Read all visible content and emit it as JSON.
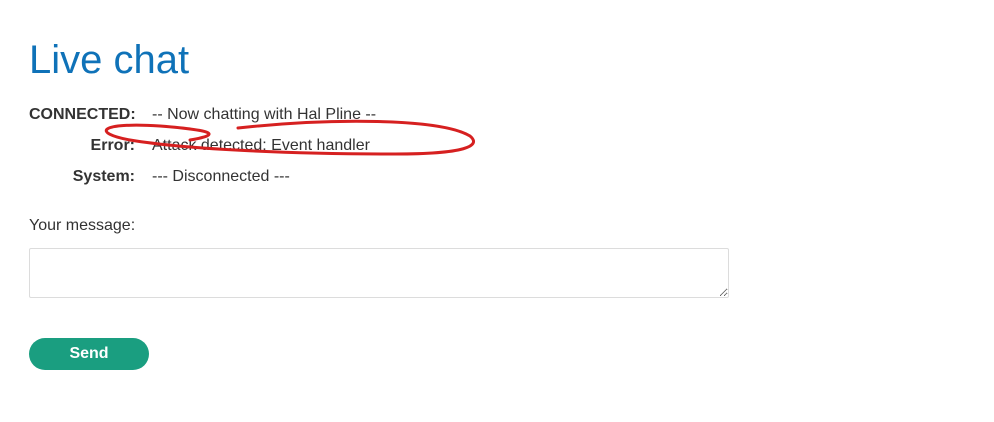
{
  "page": {
    "title": "Live chat"
  },
  "chat": {
    "messages": [
      {
        "label": "CONNECTED:",
        "text": "-- Now chatting with Hal Pline --"
      },
      {
        "label": "Error:",
        "text": "Attack detected: Event handler"
      },
      {
        "label": "System:",
        "text": "--- Disconnected ---"
      }
    ]
  },
  "form": {
    "message_label": "Your message:",
    "message_value": "",
    "send_label": "Send"
  },
  "colors": {
    "title": "#0f72b8",
    "send_button": "#1a9e80",
    "annotation": "#d62020"
  }
}
